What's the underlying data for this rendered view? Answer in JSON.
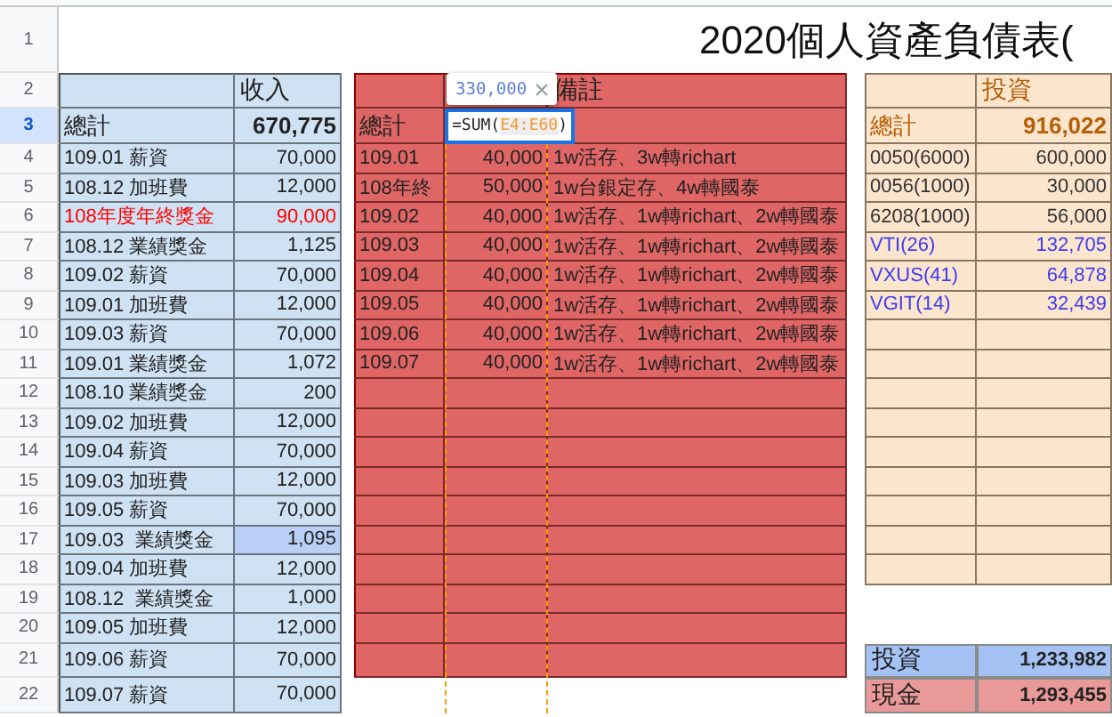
{
  "row_headers": [
    {
      "label": "1",
      "selected": false
    },
    {
      "label": "2",
      "selected": false
    },
    {
      "label": "3",
      "selected": true
    },
    {
      "label": "4",
      "selected": false
    },
    {
      "label": "5",
      "selected": false
    },
    {
      "label": "6",
      "selected": false
    },
    {
      "label": "7",
      "selected": false
    },
    {
      "label": "8",
      "selected": false
    },
    {
      "label": "9",
      "selected": false
    },
    {
      "label": "10",
      "selected": false
    },
    {
      "label": "11",
      "selected": false
    },
    {
      "label": "12",
      "selected": false
    },
    {
      "label": "13",
      "selected": false
    },
    {
      "label": "14",
      "selected": false
    },
    {
      "label": "15",
      "selected": false
    },
    {
      "label": "16",
      "selected": false
    },
    {
      "label": "17",
      "selected": false
    },
    {
      "label": "18",
      "selected": false
    },
    {
      "label": "19",
      "selected": false
    },
    {
      "label": "20",
      "selected": false
    },
    {
      "label": "21",
      "selected": false
    },
    {
      "label": "22",
      "selected": false
    }
  ],
  "title": "2020個人資產負債表(",
  "income": {
    "header": "收入",
    "total_label": "總計",
    "total": "670,775",
    "rows": [
      {
        "item": "109.01 薪資",
        "amount": "70,000",
        "color": "#222222",
        "highlighted": false
      },
      {
        "item": "108.12 加班費",
        "amount": "12,000",
        "color": "#222222",
        "highlighted": false
      },
      {
        "item": "108年度年終獎金",
        "amount": "90,000",
        "color": "#ff0000",
        "highlighted": false
      },
      {
        "item": "108.12 業績獎金",
        "amount": "1,125",
        "color": "#222222",
        "highlighted": false
      },
      {
        "item": "109.02 薪資",
        "amount": "70,000",
        "color": "#222222",
        "highlighted": false
      },
      {
        "item": "109.01 加班費",
        "amount": "12,000",
        "color": "#222222",
        "highlighted": false
      },
      {
        "item": "109.03 薪資",
        "amount": "70,000",
        "color": "#222222",
        "highlighted": false
      },
      {
        "item": "109.01 業績獎金",
        "amount": "1,072",
        "color": "#222222",
        "highlighted": false
      },
      {
        "item": "108.10 業績獎金",
        "amount": "200",
        "color": "#222222",
        "highlighted": false
      },
      {
        "item": "109.02 加班費",
        "amount": "12,000",
        "color": "#222222",
        "highlighted": false
      },
      {
        "item": "109.04 薪資",
        "amount": "70,000",
        "color": "#222222",
        "highlighted": false
      },
      {
        "item": "109.03 加班費",
        "amount": "12,000",
        "color": "#222222",
        "highlighted": false
      },
      {
        "item": "109.05 薪資",
        "amount": "70,000",
        "color": "#222222",
        "highlighted": false
      },
      {
        "item": "109.03  業績獎金",
        "amount": "1,095",
        "color": "#222222",
        "highlighted": true
      },
      {
        "item": "109.04 加班費",
        "amount": "12,000",
        "color": "#222222",
        "highlighted": false
      },
      {
        "item": "108.12  業績獎金",
        "amount": "1,000",
        "color": "#222222",
        "highlighted": false
      },
      {
        "item": "109.05 加班費",
        "amount": "12,000",
        "color": "#222222",
        "highlighted": false
      },
      {
        "item": "109.06 薪資",
        "amount": "70,000",
        "color": "#222222",
        "highlighted": false
      },
      {
        "item": "109.07 薪資",
        "amount": "70,000",
        "color": "#222222",
        "highlighted": false
      }
    ]
  },
  "savings": {
    "note_header": "備註",
    "total_label": "總計",
    "formula": {
      "function": "=SUM(",
      "range": "E4:E60",
      "close": ")"
    },
    "tooltip_value": "330,000",
    "rows": [
      {
        "period": "109.01",
        "amount": "40,000",
        "note": "1w活存、3w轉richart"
      },
      {
        "period": "108年終",
        "amount": "50,000",
        "note": "1w台銀定存、4w轉國泰"
      },
      {
        "period": "109.02",
        "amount": "40,000",
        "note": "1w活存、1w轉richart、2w轉國泰"
      },
      {
        "period": "109.03",
        "amount": "40,000",
        "note": "1w活存、1w轉richart、2w轉國泰"
      },
      {
        "period": "109.04",
        "amount": "40,000",
        "note": "1w活存、1w轉richart、2w轉國泰"
      },
      {
        "period": "109.05",
        "amount": "40,000",
        "note": "1w活存、1w轉richart、2w轉國泰"
      },
      {
        "period": "109.06",
        "amount": "40,000",
        "note": "1w活存、1w轉richart、2w轉國泰"
      },
      {
        "period": "109.07",
        "amount": "40,000",
        "note": "1w活存、1w轉richart、2w轉國泰"
      }
    ]
  },
  "investments": {
    "header": "投資",
    "total_label": "總計",
    "total": "916,022",
    "rows": [
      {
        "name": "0050(6000)",
        "value": "600,000",
        "color": "#333333"
      },
      {
        "name": "0056(1000)",
        "value": "30,000",
        "color": "#333333"
      },
      {
        "name": "6208(1000)",
        "value": "56,000",
        "color": "#333333"
      },
      {
        "name": "VTI(26)",
        "value": "132,705",
        "color": "#3c3cf0"
      },
      {
        "name": "VXUS(41)",
        "value": "64,878",
        "color": "#3c3cf0"
      },
      {
        "name": "VGIT(14)",
        "value": "32,439",
        "color": "#3c3cf0"
      }
    ]
  },
  "summary": [
    {
      "label": "投資",
      "value": "1,233,982",
      "color": "#a4c2f4"
    },
    {
      "label": "現金",
      "value": "1,293,455",
      "color": "#ea9999"
    }
  ]
}
